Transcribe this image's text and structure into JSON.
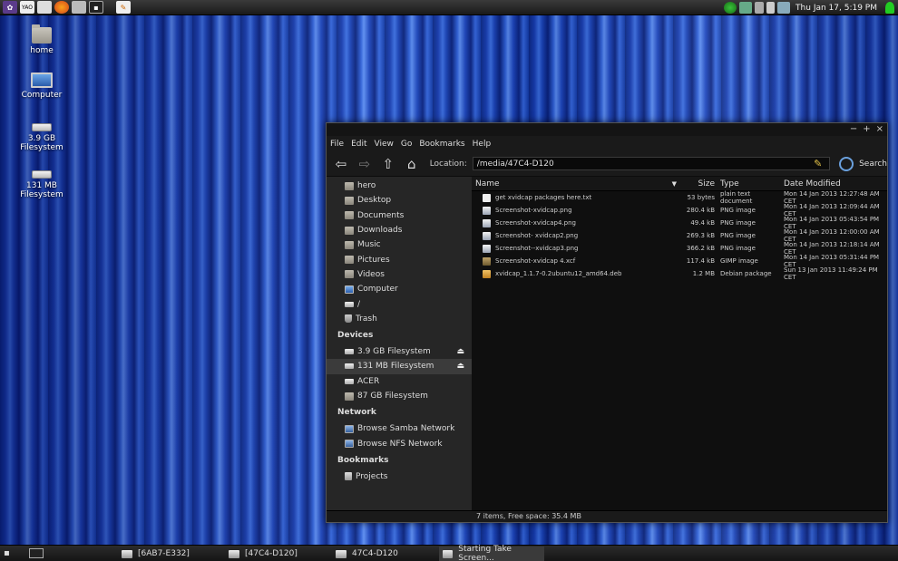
{
  "desktop": {
    "icons": [
      {
        "label": "home"
      },
      {
        "label": "Computer"
      },
      {
        "label": "3.9 GB Filesystem"
      },
      {
        "label": "131 MB Filesystem"
      }
    ]
  },
  "top_panel": {
    "launcher_text": "YAO",
    "clock": "Thu Jan 17,  5:19 PM"
  },
  "file_manager": {
    "menu": [
      "File",
      "Edit",
      "View",
      "Go",
      "Bookmarks",
      "Help"
    ],
    "location_label": "Location:",
    "location_value": "/media/47C4-D120",
    "search_label": "Search",
    "places": [
      "hero",
      "Desktop",
      "Documents",
      "Downloads",
      "Music",
      "Pictures",
      "Videos",
      "Computer",
      "/",
      "Trash"
    ],
    "devices_header": "Devices",
    "devices": [
      "3.9 GB Filesystem",
      "131 MB Filesystem",
      "ACER",
      "87 GB Filesystem"
    ],
    "network_header": "Network",
    "network": [
      "Browse Samba Network",
      "Browse NFS Network"
    ],
    "bookmarks_header": "Bookmarks",
    "bookmarks": [
      "Projects"
    ],
    "columns": {
      "name": "Name",
      "size": "Size",
      "type": "Type",
      "date": "Date Modified"
    },
    "files": [
      {
        "name": "get xvidcap packages here.txt",
        "size": "53 bytes",
        "type": "plain text document",
        "date": "Mon 14 Jan 2013 12:27:48 AM CET",
        "icon": "text-file-icon"
      },
      {
        "name": "Screenshot-xvidcap.png",
        "size": "280.4 kB",
        "type": "PNG image",
        "date": "Mon 14 Jan 2013 12:09:44 AM CET",
        "icon": "image-file-icon"
      },
      {
        "name": "Screenshot-xvidcap4.png",
        "size": "49.4 kB",
        "type": "PNG image",
        "date": "Mon 14 Jan 2013 05:43:54 PM CET",
        "icon": "image-file-icon"
      },
      {
        "name": "Screenshot- xvidcap2.png",
        "size": "269.3 kB",
        "type": "PNG image",
        "date": "Mon 14 Jan 2013 12:00:00 AM CET",
        "icon": "image-file-icon"
      },
      {
        "name": "Screenshot--xvidcap3.png",
        "size": "366.2 kB",
        "type": "PNG image",
        "date": "Mon 14 Jan 2013 12:18:14 AM CET",
        "icon": "image-file-icon"
      },
      {
        "name": "Screenshot-xvidcap 4.xcf",
        "size": "117.4 kB",
        "type": "GIMP image",
        "date": "Mon 14 Jan 2013 05:31:44 PM CET",
        "icon": "gimp-file-icon"
      },
      {
        "name": "xvidcap_1.1.7-0.2ubuntu12_amd64.deb",
        "size": "1.2 MB",
        "type": "Debian package",
        "date": "Sun 13 Jan 2013 11:49:24 PM CET",
        "icon": "package-file-icon"
      }
    ],
    "status": "7 items, Free space: 35.4 MB"
  },
  "taskbar": {
    "tasks": [
      "[6AB7-E332]",
      "[47C4-D120]",
      "47C4-D120",
      "Starting Take Screen..."
    ]
  }
}
